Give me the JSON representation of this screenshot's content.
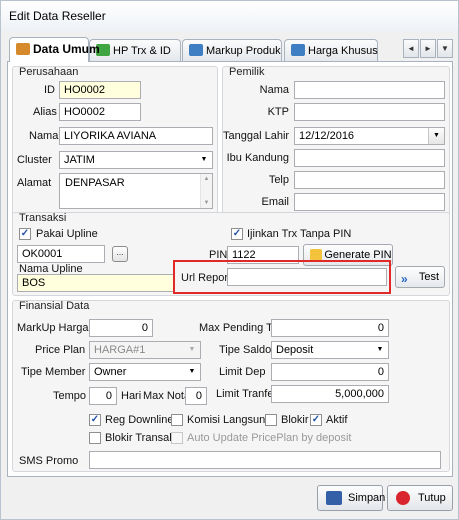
{
  "window": {
    "title": "Edit Data Reseller"
  },
  "tabs": [
    {
      "label": "Data Umum",
      "icon": "people-icon",
      "active": true
    },
    {
      "label": "HP Trx & ID",
      "icon": "pencil-icon",
      "active": false
    },
    {
      "label": "Markup Produk",
      "icon": "dollar-icon",
      "active": false
    },
    {
      "label": "Harga Khusus",
      "icon": "dollar-icon",
      "active": false
    }
  ],
  "tab_scroll": {
    "left": "◄",
    "right": "►",
    "menu": "▼"
  },
  "perusahaan": {
    "title": "Perusahaan",
    "id_label": "ID",
    "id_value": "HO0002",
    "alias_label": "Alias",
    "alias_value": "HO0002",
    "nama_label": "Nama",
    "nama_value": "LIYORIKA AVIANA",
    "cluster_label": "Cluster",
    "cluster_value": "JATIM",
    "alamat_label": "Alamat",
    "alamat_value": "DENPASAR"
  },
  "pemilik": {
    "title": "Pemilik",
    "nama_label": "Nama",
    "nama_value": "",
    "ktp_label": "KTP",
    "ktp_value": "",
    "tgl_label": "Tanggal Lahir",
    "tgl_value": "12/12/2016",
    "ibu_label": "Ibu Kandung",
    "ibu_value": "",
    "telp_label": "Telp",
    "telp_value": "",
    "email_label": "Email",
    "email_value": ""
  },
  "transaksi": {
    "title": "Transaksi",
    "pakai_upline_label": "Pakai Upline",
    "upline_code": "OK0001",
    "upline_btn": "...",
    "nama_upline_label": "Nama Upline",
    "nama_upline_value": "BOS",
    "ijinkan_label": "Ijinkan Trx Tanpa PIN",
    "pin_label": "PIN",
    "pin_value": "1122",
    "generate_pin": "Generate PIN",
    "url_report_label": "Url Report",
    "url_report_value": "",
    "test_btn": "Test"
  },
  "finansial": {
    "title": "Finansial Data",
    "markup_label": "MarkUp Harga",
    "markup_value": "0",
    "price_plan_label": "Price Plan",
    "price_plan_value": "HARGA#1",
    "tipe_member_label": "Tipe Member",
    "tipe_member_value": "Owner",
    "tempo_label": "Tempo",
    "tempo_value": "0",
    "hari_label": "Hari",
    "max_nota_label": "Max Nota",
    "max_nota_value": "0",
    "max_pending_label": "Max Pending Trx",
    "max_pending_value": "0",
    "tipe_saldo_label": "Tipe Saldo",
    "tipe_saldo_value": "Deposit",
    "limit_dep_label": "Limit Dep",
    "limit_dep_value": "0",
    "limit_transfer_label": "Limit Tranfer",
    "limit_transfer_value": "5,000,000",
    "reg_downline": "Reg Downline",
    "komisi_langsung": "Komisi Langsung",
    "blokir": "Blokir",
    "aktif": "Aktif",
    "blokir_transaksi": "Blokir Transaksi",
    "auto_update": "Auto Update PricePlan by deposit",
    "sms_promo_label": "SMS Promo",
    "sms_promo_value": ""
  },
  "checkbox_mark": "✓",
  "dropdown_arrow": "▼",
  "scroll_up": "▲",
  "scroll_down": "▼",
  "footer": {
    "simpan": "Simpan",
    "tutup": "Tutup"
  },
  "colors": {
    "highlight": "#e02a2a",
    "yellow_field": "#ffffdd",
    "accent": "#2353a6"
  }
}
